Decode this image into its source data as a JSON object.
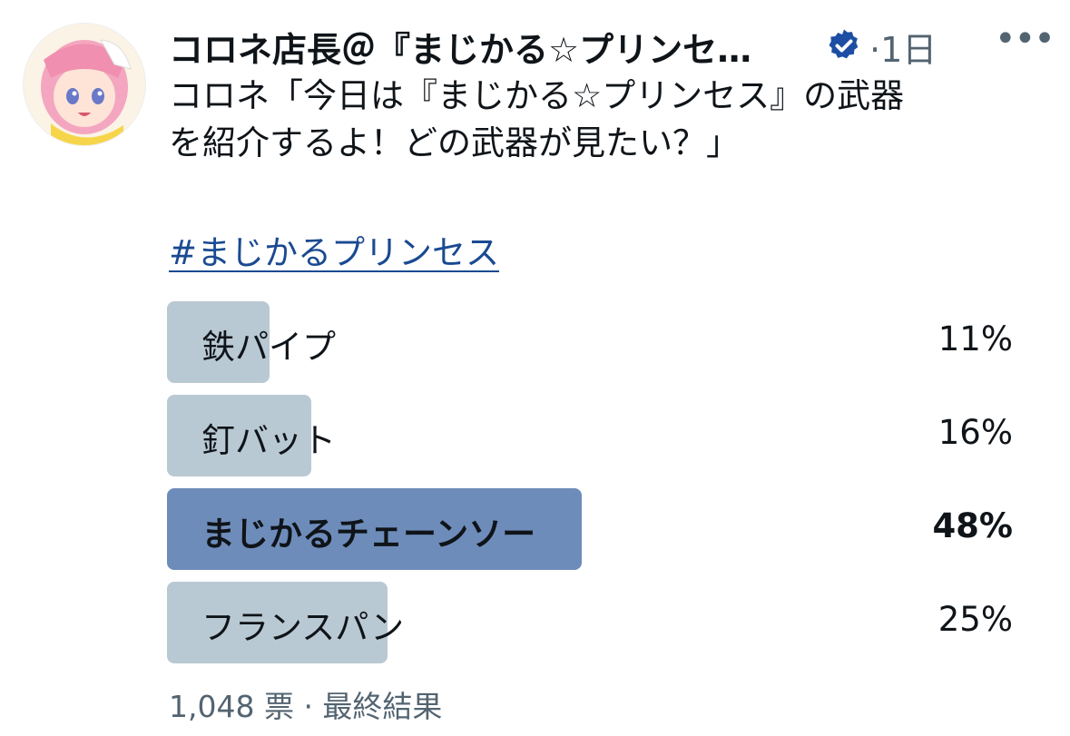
{
  "post": {
    "author_name": "コロネ店長＠『まじかる☆プリンセ…",
    "separator": "·",
    "time": "1日",
    "more_label": "•••",
    "text_line1": "コロネ「今日は『まじかる☆プリンセス』の武器",
    "text_line2": "を紹介するよ！どの武器が見たい？」",
    "hashtag": "#まじかるプリンセス"
  },
  "poll": {
    "options": [
      {
        "label": "鉄パイプ",
        "percent_text": "11%",
        "value": 11
      },
      {
        "label": "釘バット",
        "percent_text": "16%",
        "value": 16
      },
      {
        "label": "まじかるチェーンソー",
        "percent_text": "48%",
        "value": 48,
        "winner": true
      },
      {
        "label": "フランスパン",
        "percent_text": "25%",
        "value": 25
      }
    ],
    "footer": "1,048 票 · 最終結果"
  },
  "colors": {
    "bar": "#b9c9d3",
    "winner_bar": "#6e8cba",
    "hashtag": "#1a4a91",
    "verified": "#1d4ea4",
    "muted": "#536471"
  },
  "icons": {
    "verified": "verified-badge-icon",
    "more": "more-dots-icon"
  }
}
